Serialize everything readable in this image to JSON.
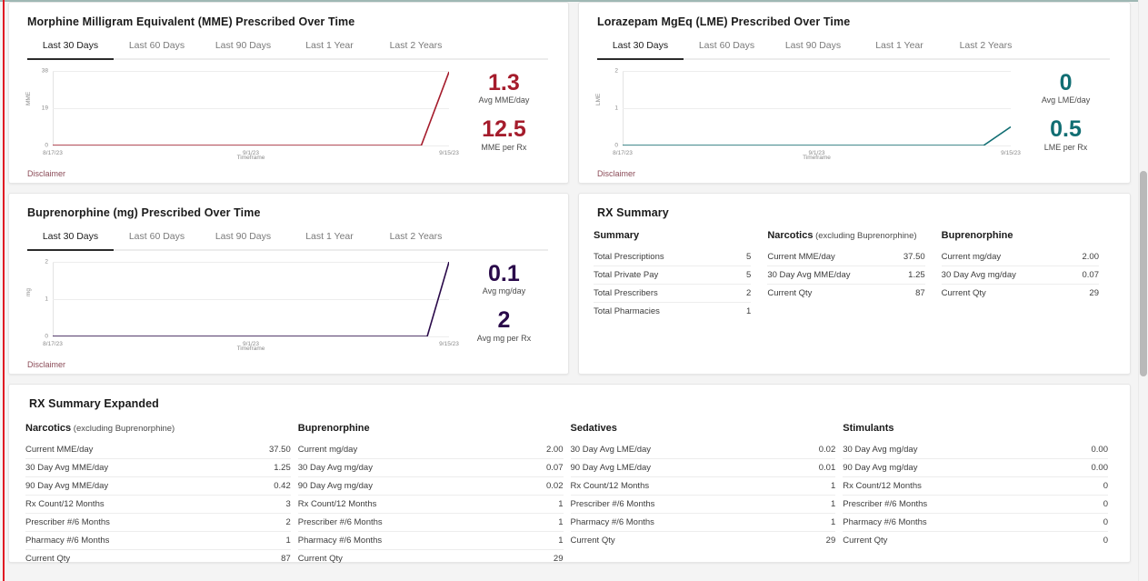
{
  "colors": {
    "mme": "#a51c2c",
    "lme": "#116e73",
    "bup": "#2a0a4a",
    "accent_red": "#e01b24",
    "top_rule": "#9fb8b4"
  },
  "timeframe_tabs": [
    "Last 30 Days",
    "Last 60 Days",
    "Last 90 Days",
    "Last 1 Year",
    "Last 2 Years"
  ],
  "active_tab": "Last 30 Days",
  "disclaimer_label": "Disclaimer",
  "cards": {
    "mme": {
      "title": "Morphine Milligram Equivalent (MME) Prescribed Over Time",
      "stat1_value": "1.3",
      "stat1_label": "Avg MME/day",
      "stat2_value": "12.5",
      "stat2_label": "MME per Rx"
    },
    "lme": {
      "title": "Lorazepam MgEq (LME) Prescribed Over Time",
      "stat1_value": "0",
      "stat1_label": "Avg LME/day",
      "stat2_value": "0.5",
      "stat2_label": "LME per Rx"
    },
    "bup": {
      "title": "Buprenorphine (mg) Prescribed Over Time",
      "stat1_value": "0.1",
      "stat1_label": "Avg mg/day",
      "stat2_value": "2",
      "stat2_label": "Avg mg per Rx"
    },
    "rx_summary": {
      "title": "RX Summary"
    },
    "rx_summary_expanded": {
      "title": "RX Summary Expanded"
    }
  },
  "chart_data": [
    {
      "id": "mme",
      "type": "line",
      "title": "Morphine Milligram Equivalent (MME) Prescribed Over Time",
      "xlabel": "Timeframe",
      "ylabel": "MME",
      "yticks": [
        "0",
        "19",
        "38"
      ],
      "ylim": [
        0,
        38
      ],
      "xticks": [
        "8/17/23",
        "9/1/23",
        "9/15/23"
      ],
      "xlim": [
        "8/17/23",
        "9/15/23"
      ],
      "grid": true,
      "color": "#a51c2c",
      "x": [
        0,
        0.93,
        1.0
      ],
      "values": [
        0,
        0,
        37.5
      ]
    },
    {
      "id": "lme",
      "type": "line",
      "title": "Lorazepam MgEq (LME) Prescribed Over Time",
      "xlabel": "Timeframe",
      "ylabel": "LME",
      "yticks": [
        "0",
        "1",
        "2"
      ],
      "ylim": [
        0,
        2
      ],
      "xticks": [
        "8/17/23",
        "9/1/23",
        "9/15/23"
      ],
      "xlim": [
        "8/17/23",
        "9/15/23"
      ],
      "grid": true,
      "color": "#116e73",
      "x": [
        0,
        0.93,
        1.0
      ],
      "values": [
        0,
        0,
        0.5
      ]
    },
    {
      "id": "bup",
      "type": "line",
      "title": "Buprenorphine (mg) Prescribed Over Time",
      "xlabel": "Timeframe",
      "ylabel": "mg",
      "yticks": [
        "0",
        "1",
        "2"
      ],
      "ylim": [
        0,
        2
      ],
      "xticks": [
        "8/17/23",
        "9/1/23",
        "9/15/23"
      ],
      "xlim": [
        "8/17/23",
        "9/15/23"
      ],
      "grid": true,
      "color": "#2a0a4a",
      "x": [
        0,
        0.945,
        1.0
      ],
      "values": [
        0,
        0,
        2
      ]
    }
  ],
  "rx_summary": {
    "columns": [
      {
        "heading": "Summary",
        "sub": "",
        "rows": [
          {
            "label": "Total Prescriptions",
            "value": "5"
          },
          {
            "label": "Total Private Pay",
            "value": "5"
          },
          {
            "label": "Total Prescribers",
            "value": "2"
          },
          {
            "label": "Total Pharmacies",
            "value": "1"
          }
        ]
      },
      {
        "heading": "Narcotics",
        "sub": "(excluding Buprenorphine)",
        "rows": [
          {
            "label": "Current MME/day",
            "value": "37.50"
          },
          {
            "label": "30 Day Avg MME/day",
            "value": "1.25"
          },
          {
            "label": "Current Qty",
            "value": "87"
          }
        ]
      },
      {
        "heading": "Buprenorphine",
        "sub": "",
        "rows": [
          {
            "label": "Current mg/day",
            "value": "2.00"
          },
          {
            "label": "30 Day Avg mg/day",
            "value": "0.07"
          },
          {
            "label": "Current Qty",
            "value": "29"
          }
        ]
      }
    ]
  },
  "rx_summary_expanded": {
    "columns": [
      {
        "heading": "Narcotics",
        "sub": "(excluding Buprenorphine)",
        "rows": [
          {
            "label": "Current MME/day",
            "value": "37.50"
          },
          {
            "label": "30 Day Avg MME/day",
            "value": "1.25"
          },
          {
            "label": "90 Day Avg MME/day",
            "value": "0.42"
          },
          {
            "label": "Rx Count/12 Months",
            "value": "3"
          },
          {
            "label": "Prescriber #/6 Months",
            "value": "2"
          },
          {
            "label": "Pharmacy #/6 Months",
            "value": "1"
          },
          {
            "label": "Current Qty",
            "value": "87"
          }
        ]
      },
      {
        "heading": "Buprenorphine",
        "sub": "",
        "rows": [
          {
            "label": "Current mg/day",
            "value": "2.00"
          },
          {
            "label": "30 Day Avg mg/day",
            "value": "0.07"
          },
          {
            "label": "90 Day Avg mg/day",
            "value": "0.02"
          },
          {
            "label": "Rx Count/12 Months",
            "value": "1"
          },
          {
            "label": "Prescriber #/6 Months",
            "value": "1"
          },
          {
            "label": "Pharmacy #/6 Months",
            "value": "1"
          },
          {
            "label": "Current Qty",
            "value": "29"
          }
        ]
      },
      {
        "heading": "Sedatives",
        "sub": "",
        "rows": [
          {
            "label": "30 Day Avg LME/day",
            "value": "0.02"
          },
          {
            "label": "90 Day Avg LME/day",
            "value": "0.01"
          },
          {
            "label": "Rx Count/12 Months",
            "value": "1"
          },
          {
            "label": "Prescriber #/6 Months",
            "value": "1"
          },
          {
            "label": "Pharmacy #/6 Months",
            "value": "1"
          },
          {
            "label": "Current Qty",
            "value": "29"
          }
        ]
      },
      {
        "heading": "Stimulants",
        "sub": "",
        "rows": [
          {
            "label": "30 Day Avg mg/day",
            "value": "0.00"
          },
          {
            "label": "90 Day Avg mg/day",
            "value": "0.00"
          },
          {
            "label": "Rx Count/12 Months",
            "value": "0"
          },
          {
            "label": "Prescriber #/6 Months",
            "value": "0"
          },
          {
            "label": "Pharmacy #/6 Months",
            "value": "0"
          },
          {
            "label": "Current Qty",
            "value": "0"
          }
        ]
      }
    ]
  }
}
